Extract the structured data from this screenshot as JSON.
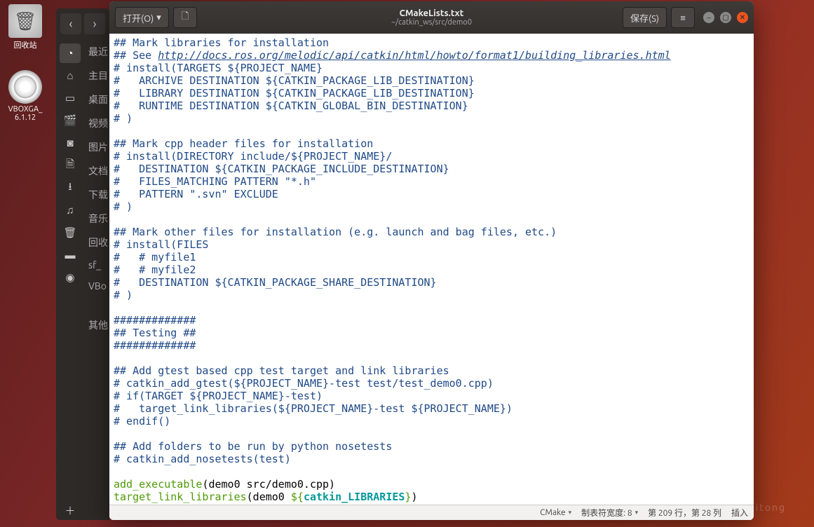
{
  "desktop": {
    "trash_label": "回收站",
    "cd_label": "VBOXGA_\n6.1.12"
  },
  "nautilus_places": [
    "最近",
    "主目",
    "桌面",
    "视频",
    "图片",
    "文档",
    "下载",
    "音乐",
    "回收",
    "sf_",
    "VBo",
    "其他"
  ],
  "gedit": {
    "open_btn": "打开(O)",
    "save_btn": "保存(S)",
    "title": "CMakeLists.txt",
    "subtitle": "~/catkin_ws/src/demo0",
    "status": {
      "lang": "CMake",
      "tabwidth": "制表符宽度: 8",
      "cursor": "第 209 行，第 28 列",
      "mode": "插入"
    },
    "code": {
      "l1": "## Mark libraries for installation",
      "l2a": "## See ",
      "l2b": "http://docs.ros.org/melodic/api/catkin/html/howto/format1/building_libraries.html",
      "l3": "# install(TARGETS ${PROJECT_NAME}",
      "l4": "#   ARCHIVE DESTINATION ${CATKIN_PACKAGE_LIB_DESTINATION}",
      "l5": "#   LIBRARY DESTINATION ${CATKIN_PACKAGE_LIB_DESTINATION}",
      "l6": "#   RUNTIME DESTINATION ${CATKIN_GLOBAL_BIN_DESTINATION}",
      "l7": "# )",
      "l8": "## Mark cpp header files for installation",
      "l9": "# install(DIRECTORY include/${PROJECT_NAME}/",
      "l10": "#   DESTINATION ${CATKIN_PACKAGE_INCLUDE_DESTINATION}",
      "l11": "#   FILES_MATCHING PATTERN \"*.h\"",
      "l12": "#   PATTERN \".svn\" EXCLUDE",
      "l13": "# )",
      "l14": "## Mark other files for installation (e.g. launch and bag files, etc.)",
      "l15": "# install(FILES",
      "l16": "#   # myfile1",
      "l17": "#   # myfile2",
      "l18": "#   DESTINATION ${CATKIN_PACKAGE_SHARE_DESTINATION}",
      "l19": "# )",
      "l20": "#############",
      "l21": "## Testing ##",
      "l22": "#############",
      "l23": "## Add gtest based cpp test target and link libraries",
      "l24": "# catkin_add_gtest(${PROJECT_NAME}-test test/test_demo0.cpp)",
      "l25": "# if(TARGET ${PROJECT_NAME}-test)",
      "l26": "#   target_link_libraries(${PROJECT_NAME}-test ${PROJECT_NAME})",
      "l27": "# endif()",
      "l28": "## Add folders to be run by python nosetests",
      "l29": "# catkin_add_nosetests(test)",
      "l30a": "add_executable",
      "l30b": "(demo0 src/demo0.cpp)",
      "l31a": "target_link_libraries",
      "l31b": "(demo0 ",
      "l31c": "${",
      "l31d": "catkin_LIBRARIES",
      "l31e": "}",
      "l31f": ")"
    }
  },
  "watermark": "liuzhitong"
}
